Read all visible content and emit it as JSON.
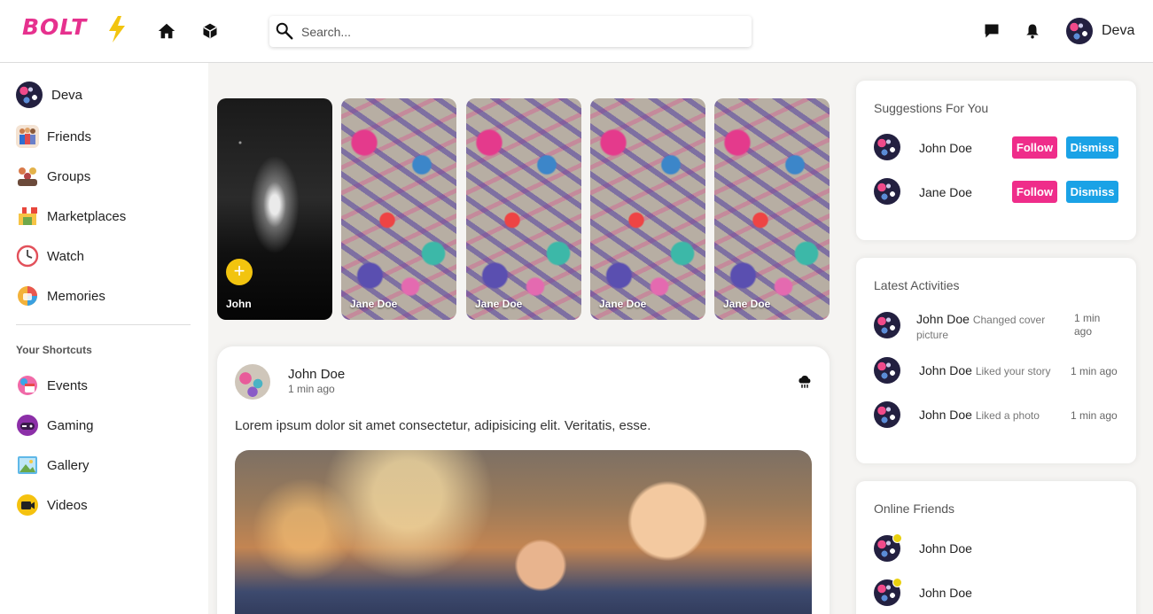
{
  "brand": {
    "name": "BOLT",
    "primary_color": "#e6318e",
    "accent_color": "#f2c40f"
  },
  "topbar": {
    "nav_icons": [
      "home-icon",
      "cube-icon"
    ],
    "search": {
      "placeholder": "Search...",
      "value": ""
    },
    "icons": [
      "chat-icon",
      "bell-icon"
    ],
    "user": {
      "name": "Deva"
    }
  },
  "sidebar": {
    "profile": {
      "name": "Deva"
    },
    "items": [
      {
        "label": "Friends",
        "icon": "friends-icon"
      },
      {
        "label": "Groups",
        "icon": "groups-icon"
      },
      {
        "label": "Marketplaces",
        "icon": "marketplace-icon"
      },
      {
        "label": "Watch",
        "icon": "watch-icon"
      },
      {
        "label": "Memories",
        "icon": "memories-icon"
      }
    ],
    "shortcuts_heading": "Your Shortcuts",
    "shortcuts": [
      {
        "label": "Events",
        "icon": "events-icon"
      },
      {
        "label": "Gaming",
        "icon": "gaming-icon"
      },
      {
        "label": "Gallery",
        "icon": "gallery-icon"
      },
      {
        "label": "Videos",
        "icon": "videos-icon"
      }
    ]
  },
  "stories": [
    {
      "name": "John",
      "own": true,
      "add_label": "+"
    },
    {
      "name": "Jane Doe"
    },
    {
      "name": "Jane Doe"
    },
    {
      "name": "Jane Doe"
    },
    {
      "name": "Jane Doe"
    }
  ],
  "post": {
    "author": "John Doe",
    "time": "1 min ago",
    "text": "Lorem ipsum dolor sit amet consectetur, adipisicing elit. Veritatis, esse."
  },
  "suggestions": {
    "title": "Suggestions For You",
    "follow_label": "Follow",
    "dismiss_label": "Dismiss",
    "people": [
      {
        "name": "John Doe"
      },
      {
        "name": "Jane Doe"
      }
    ]
  },
  "activities": {
    "title": "Latest Activities",
    "items": [
      {
        "name": "John Doe",
        "action": "Changed cover picture",
        "time": "1 min ago"
      },
      {
        "name": "John Doe",
        "action": "Liked your story",
        "time": "1 min ago"
      },
      {
        "name": "John Doe",
        "action": "Liked a photo",
        "time": "1 min ago"
      }
    ]
  },
  "online": {
    "title": "Online Friends",
    "status_color": "#e9d00f",
    "friends": [
      {
        "name": "John Doe"
      },
      {
        "name": "John Doe"
      }
    ]
  }
}
